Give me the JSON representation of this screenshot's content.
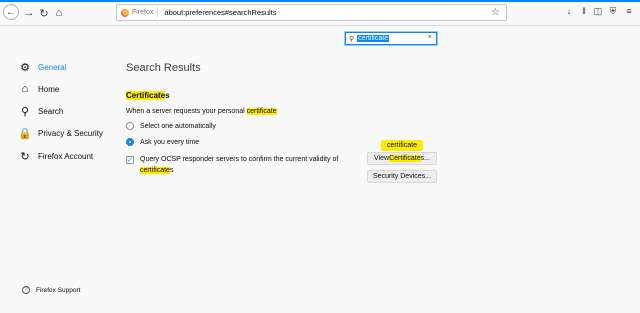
{
  "browser": {
    "brand": "Firefox",
    "url": "about:preferences#searchResults",
    "colors": {
      "accent": "#0a84ff",
      "highlight": "#ffe900"
    }
  },
  "search": {
    "value": "certificate",
    "icon": "search-icon"
  },
  "sidebar": {
    "items": [
      {
        "label": "General",
        "icon": "gear-icon",
        "selected": true
      },
      {
        "label": "Home",
        "icon": "home-icon"
      },
      {
        "label": "Search",
        "icon": "search-icon"
      },
      {
        "label": "Privacy & Security",
        "icon": "lock-icon"
      },
      {
        "label": "Firefox Account",
        "icon": "sync-icon"
      }
    ],
    "support_label": "Firefox Support"
  },
  "main": {
    "title": "Search Results",
    "section": {
      "highlight": "Certificate",
      "rest": "s"
    },
    "description": {
      "prefix": "When a server requests your personal ",
      "highlight": "certificate"
    },
    "options": [
      {
        "label": "Select one automatically",
        "checked": false
      },
      {
        "label": "Ask you every time",
        "checked": true
      }
    ],
    "ocsp": {
      "prefix": "Query OCSP responder servers to confirm the current validity of ",
      "highlight": "certificate",
      "suffix": "s",
      "checked": true
    },
    "tooltip": "certificate",
    "view_button": {
      "prefix": "View ",
      "highlight": "Certificate",
      "suffix": "s..."
    },
    "security_button": "Security Devices..."
  }
}
